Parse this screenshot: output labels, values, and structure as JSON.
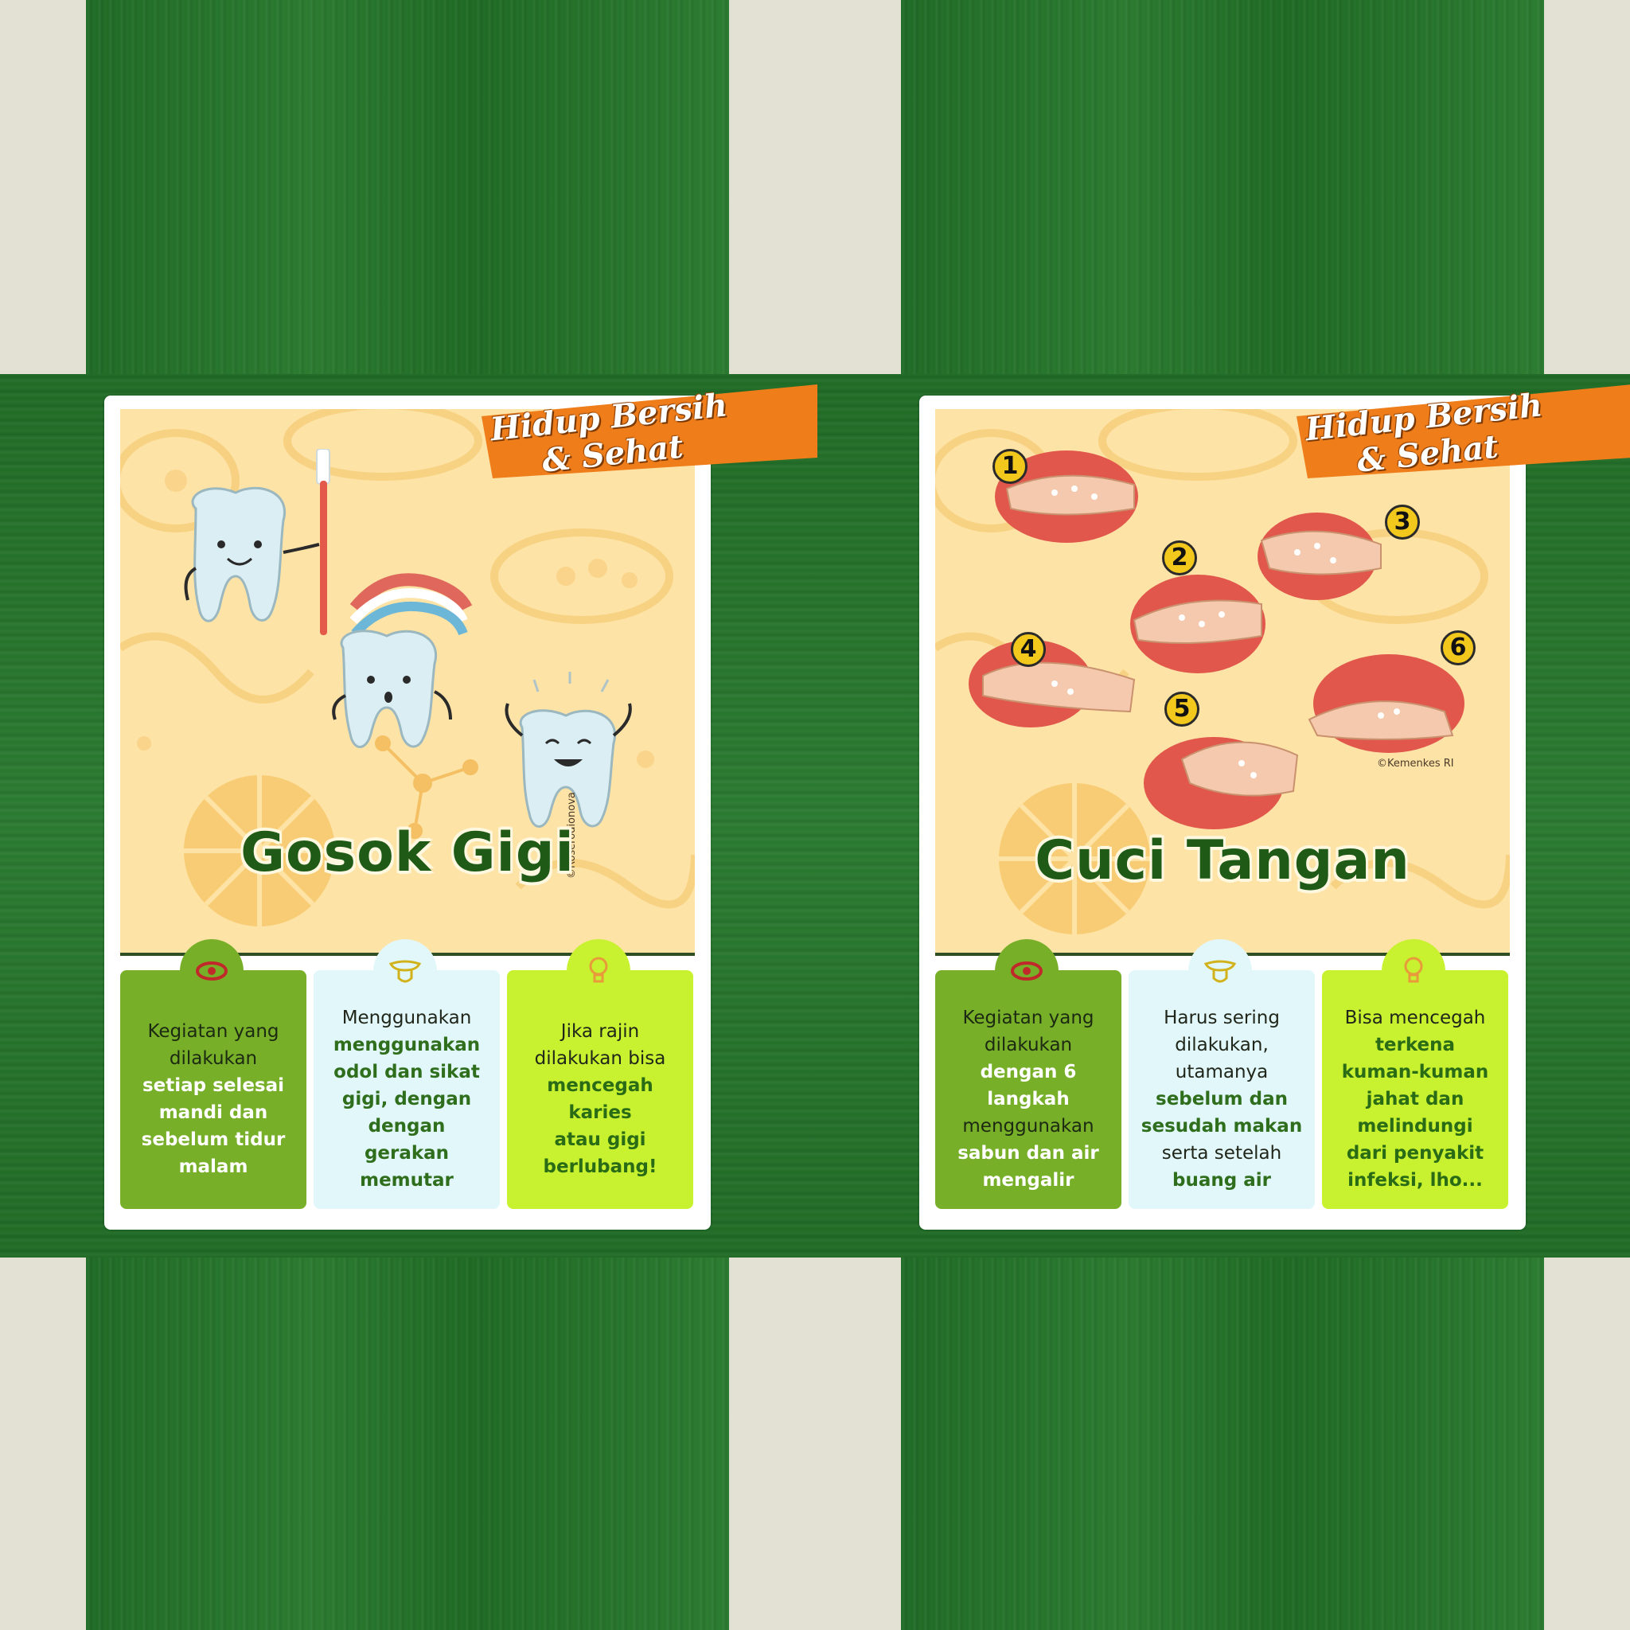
{
  "colors": {
    "background": "#e3e1d3",
    "band_green": "#2a7a2f",
    "card_bg": "#fde3a6",
    "ribbon": "#ef7d1a",
    "title": "#1f5a17",
    "box_green": "#77af29",
    "box_light": "#e2f7f9",
    "box_lime": "#c8f12f"
  },
  "cards": [
    {
      "ribbon": {
        "line1": "Hidup Bersih",
        "line2": "& Sehat"
      },
      "title": "Gosok Gigi",
      "credit": "©Roserodionova",
      "boxes": [
        {
          "icon": "eye-icon",
          "lines": [
            "Kegiatan yang",
            "dilakukan",
            "setiap selesai",
            "mandi dan",
            "sebelum tidur",
            "malam"
          ]
        },
        {
          "icon": "tongue-icon",
          "lines": [
            "Menggunakan",
            "menggunakan",
            "odol dan sikat",
            "gigi, dengan",
            "dengan gerakan",
            "memutar"
          ]
        },
        {
          "icon": "lightbulb-icon",
          "lines": [
            "Jika rajin",
            "dilakukan bisa",
            "mencegah karies",
            "atau gigi",
            "berlubang!"
          ]
        }
      ]
    },
    {
      "ribbon": {
        "line1": "Hidup Bersih",
        "line2": "& Sehat"
      },
      "title": "Cuci Tangan",
      "credit": "©Kemenkes RI",
      "steps": [
        "1",
        "2",
        "3",
        "4",
        "5",
        "6"
      ],
      "boxes": [
        {
          "icon": "eye-icon",
          "lines": [
            "Kegiatan yang",
            "dilakukan",
            "dengan 6",
            "langkah",
            "menggunakan",
            "sabun dan air",
            "mengalir"
          ]
        },
        {
          "icon": "tongue-icon",
          "lines": [
            "Harus sering",
            "dilakukan,",
            "utamanya",
            "sebelum dan",
            "sesudah makan",
            "serta setelah",
            "buang air"
          ]
        },
        {
          "icon": "lightbulb-icon",
          "lines": [
            "Bisa mencegah",
            "terkena",
            "kuman-kuman",
            "jahat dan",
            "melindungi",
            "dari penyakit",
            "infeksi, lho..."
          ]
        }
      ]
    }
  ]
}
